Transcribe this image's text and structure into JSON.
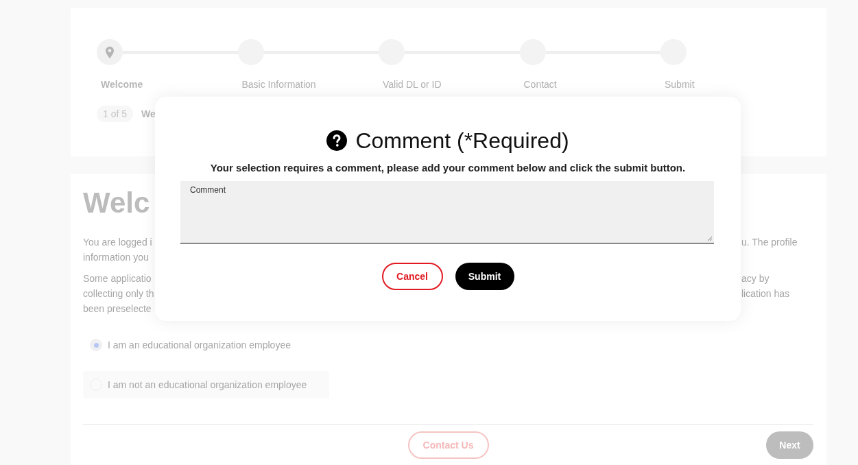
{
  "stepper": {
    "steps": [
      {
        "label": "Welcome",
        "selected": true
      },
      {
        "label": "Basic Information",
        "selected": false
      },
      {
        "label": "Valid DL or ID",
        "selected": false
      },
      {
        "label": "Contact",
        "selected": false
      },
      {
        "label": "Submit",
        "selected": false
      }
    ]
  },
  "step_counter": {
    "badge": "1 of 5",
    "title": "We"
  },
  "welcome": {
    "heading": "Welc",
    "paragraphs": [
      {
        "left": [
          "You are logged i",
          "information you"
        ],
        "right": [
          "u. The profile"
        ]
      },
      {
        "left": [
          "Some applicatio",
          "collecting only th",
          "been preselecte"
        ],
        "right": [
          "acy by",
          "lication has"
        ]
      }
    ],
    "options": [
      {
        "label": "I am an educational organization employee",
        "selected": true
      },
      {
        "label": "I am not an educational organization employee",
        "selected": false
      }
    ]
  },
  "footer": {
    "contact_button": "Contact Us",
    "next_button": {
      "label": "Next",
      "disabled": true
    }
  },
  "modal": {
    "title": "Comment (*Required)",
    "message": "Your selection requires a comment, please add your comment below and click the submit button.",
    "field": {
      "label": "Comment"
    },
    "buttons": [
      {
        "label": "Cancel",
        "kind": "secondary"
      },
      {
        "label": "Submit",
        "kind": "primary"
      }
    ]
  }
}
